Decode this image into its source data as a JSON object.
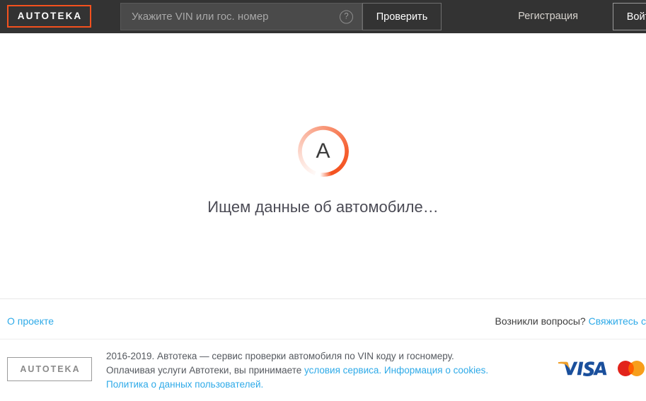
{
  "header": {
    "logo_text": "AUTOTEKA",
    "logo_border_color": "#f4511e",
    "background_color": "#333333",
    "search": {
      "placeholder": "Укажите VIN или гос. номер",
      "value": "",
      "help_icon": "question-circle-icon",
      "help_icon_glyph": "?"
    },
    "check_button_label": "Проверить",
    "register_link_label": "Регистрация",
    "login_button_label": "Войти"
  },
  "main": {
    "spinner": {
      "letter": "A",
      "accent_color": "#f4511e"
    },
    "loading_text": "Ищем данные об автомобиле…"
  },
  "footer": {
    "about_link_label": "О проекте",
    "questions_text": "Возникли вопросы?",
    "contact_link_label": "Свяжитесь с",
    "logo_text": "AUTOTEKA",
    "copyright_line1": "2016-2019. Автотека — сервис проверки автомобиля по VIN коду и госномеру.",
    "copyright_line2_prefix": "Оплачивая услуги Автотеки, вы принимаете ",
    "terms_link_label": "условия сервиса.",
    "cookies_link_label": "Информация о cookies.",
    "privacy_link_label": "Политика о данных пользователей.",
    "link_color": "#2eaae8",
    "payment_icons": [
      {
        "name": "visa-logo",
        "label": "VISA"
      },
      {
        "name": "mastercard-logo",
        "label": "Mastercard"
      }
    ]
  }
}
